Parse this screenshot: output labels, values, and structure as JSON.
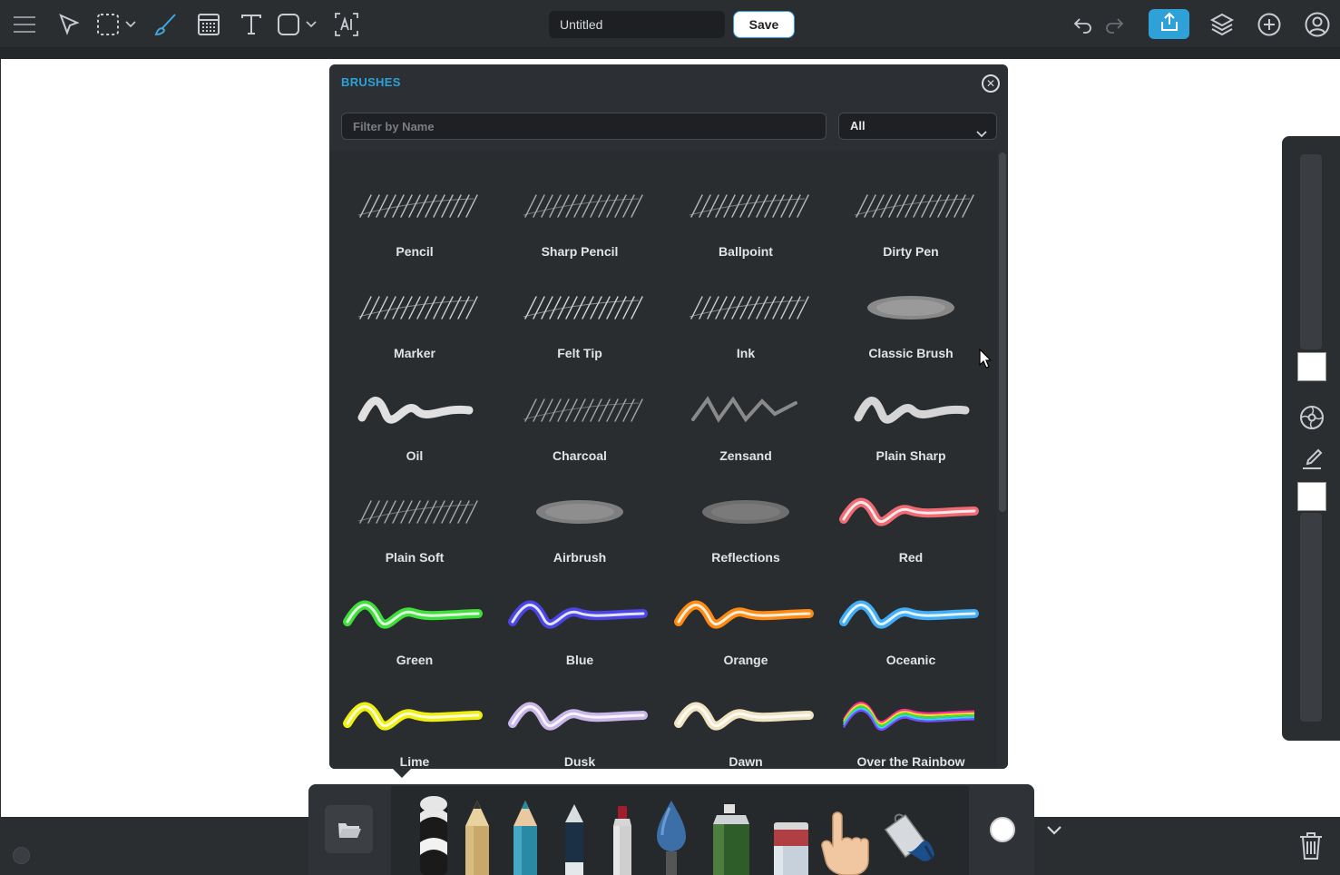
{
  "toolbar": {
    "document_title": "Untitled",
    "save_label": "Save",
    "icons": [
      "menu-icon",
      "select-arrow-icon",
      "marquee-select-icon",
      "brush-icon",
      "gradient-fill-icon",
      "text-icon",
      "shape-icon",
      "ai-icon",
      "undo-icon",
      "redo-icon",
      "share-icon",
      "layers-icon",
      "add-icon",
      "account-icon"
    ],
    "accent_color": "#2ea1d8"
  },
  "brush_panel": {
    "title": "BRUSHES",
    "filter_placeholder": "Filter by Name",
    "category_selected": "All",
    "brushes": [
      {
        "name": "Pencil",
        "style": "sketch",
        "color": "#bbbbbb"
      },
      {
        "name": "Sharp Pencil",
        "style": "sketch",
        "color": "#a8a8a8"
      },
      {
        "name": "Ballpoint",
        "style": "sketch",
        "color": "#b5b5b5"
      },
      {
        "name": "Dirty Pen",
        "style": "sketch",
        "color": "#b0b0b0"
      },
      {
        "name": "Marker",
        "style": "sketch",
        "color": "#c8c8c8"
      },
      {
        "name": "Felt Tip",
        "style": "sketch",
        "color": "#d0d0d0"
      },
      {
        "name": "Ink",
        "style": "sketch",
        "color": "#c5c5c5"
      },
      {
        "name": "Classic Brush",
        "style": "blob",
        "color": "#9a9a9a"
      },
      {
        "name": "Oil",
        "style": "thick",
        "color": "#e0e0e0"
      },
      {
        "name": "Charcoal",
        "style": "sketch",
        "color": "#a0a0a0"
      },
      {
        "name": "Zensand",
        "style": "wave",
        "color": "#8a8a8a"
      },
      {
        "name": "Plain Sharp",
        "style": "thick",
        "color": "#d5d5d5"
      },
      {
        "name": "Plain Soft",
        "style": "sketch",
        "color": "#a5a5a5"
      },
      {
        "name": "Airbrush",
        "style": "blob",
        "color": "#8e8e8e"
      },
      {
        "name": "Reflections",
        "style": "blob",
        "color": "#7a7a7a"
      },
      {
        "name": "Red",
        "style": "color",
        "color": "#f06b73"
      },
      {
        "name": "Green",
        "style": "color",
        "color": "#3ee03a"
      },
      {
        "name": "Blue",
        "style": "color",
        "color": "#4b45e8"
      },
      {
        "name": "Orange",
        "style": "color",
        "color": "#ff8a12"
      },
      {
        "name": "Oceanic",
        "style": "color",
        "color": "#41aef5"
      },
      {
        "name": "Lime",
        "style": "color",
        "color": "#f0f010"
      },
      {
        "name": "Dusk",
        "style": "color",
        "color": "#c9b7ea"
      },
      {
        "name": "Dawn",
        "style": "color",
        "color": "#efe3c2"
      },
      {
        "name": "Over the Rainbow",
        "style": "rainbow",
        "color": "#3ad0ff"
      }
    ]
  },
  "tool_tray": {
    "tools": [
      "folder-icon",
      "roller-brush-tool",
      "pencil-tool",
      "colored-pencil-tool",
      "fountain-pen-tool",
      "marker-tool",
      "paintbrush-tool",
      "spray-can-tool",
      "eraser-tool",
      "finger-smudge-tool",
      "bucket-fill-tool"
    ],
    "current_color": "#ffffff"
  },
  "right_panel": {
    "primary_color": "#ffffff",
    "secondary_color": "#ffffff"
  }
}
